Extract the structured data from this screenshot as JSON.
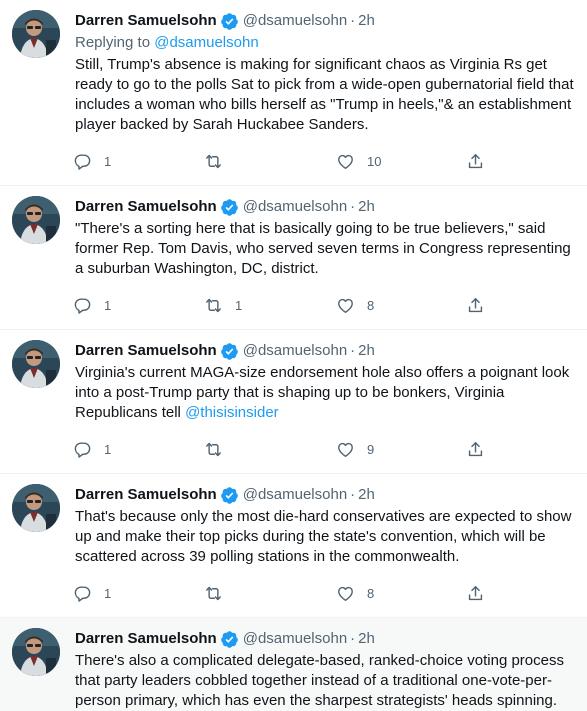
{
  "author": {
    "name": "Darren Samuelsohn",
    "handle": "@dsamuelsohn",
    "separator": "·"
  },
  "icons": {
    "verified": "verified-badge-icon",
    "reply": "reply-icon",
    "retweet": "retweet-icon",
    "like": "heart-icon",
    "share": "share-icon"
  },
  "colors": {
    "accent": "#1d9bf0",
    "secondary_text": "#536471",
    "highlight_bg": "#f7f9f9"
  },
  "tweets": [
    {
      "time": "2h",
      "replying_prefix": "Replying to ",
      "replying_to": "@dsamuelsohn",
      "text": "Still, Trump's absence is making for significant chaos as Virginia Rs get ready to go to the polls Sat to pick from a wide-open gubernatorial field that includes a woman who bills herself as \"Trump in heels,\"& an establishment player backed by Sarah Huckabee Sanders.",
      "replies": "1",
      "retweets": "",
      "likes": "10"
    },
    {
      "time": "2h",
      "text": "\"There's a sorting here that is basically going to be true believers,\" said former Rep. Tom Davis, who served seven terms in Congress representing a suburban Washington, DC, district.",
      "replies": "1",
      "retweets": "1",
      "likes": "8"
    },
    {
      "time": "2h",
      "text": "Virginia's current MAGA-size endorsement hole also offers a poignant look into a post-Trump party that is shaping up to be bonkers, Virginia Republicans tell ",
      "text_mention": "@thisisinsider",
      "replies": "1",
      "retweets": "",
      "likes": "9"
    },
    {
      "time": "2h",
      "text": "That's because only the most die-hard conservatives are expected to show up and make their top picks during the state's convention, which will be scattered across 39 polling stations in the commonwealth.",
      "replies": "1",
      "retweets": "",
      "likes": "8"
    },
    {
      "time": "2h",
      "text": "There's also a complicated delegate-based, ranked-choice voting process that party leaders cobbled together instead of a traditional one-vote-per-person primary, which has even the sharpest strategists' heads spinning."
    }
  ]
}
